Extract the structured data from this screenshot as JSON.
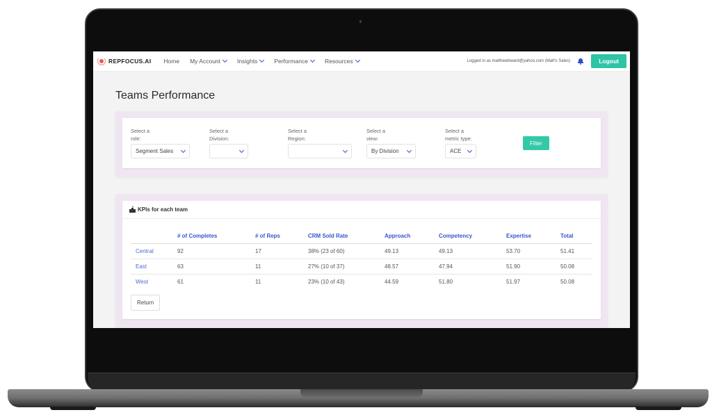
{
  "nav": {
    "brand": "REPFOCUS.AI",
    "items": [
      {
        "label": "Home",
        "has_dropdown": false
      },
      {
        "label": "My Account",
        "has_dropdown": true
      },
      {
        "label": "Insights",
        "has_dropdown": true
      },
      {
        "label": "Performance",
        "has_dropdown": true
      },
      {
        "label": "Resources",
        "has_dropdown": true
      }
    ],
    "logged_in_text": "Logged in as matthewbward@yahoo.com (Matt's Sales)",
    "logout_label": "Logout",
    "accent_color": "#2ec4a5",
    "link_color": "#2f4fc7"
  },
  "page": {
    "title": "Teams Performance"
  },
  "filters": {
    "role": {
      "label_line1": "Select a",
      "label_line2": "role:",
      "value": "Segment Sales"
    },
    "division": {
      "label_line1": "Select a",
      "label_line2": "Division:",
      "value": ""
    },
    "region": {
      "label_line1": "Select a",
      "label_line2": "Region:",
      "value": ""
    },
    "view": {
      "label_line1": "Select a",
      "label_line2": "view:",
      "value": "By Division"
    },
    "metric": {
      "label_line1": "Select a",
      "label_line2": "metric type:",
      "value": "ACE"
    },
    "filter_label": "Filter"
  },
  "kpi": {
    "heading": "KPIs for each team",
    "columns": [
      "",
      "# of Completes",
      "# of Reps",
      "CRM Sold Rate",
      "Approach",
      "Competency",
      "Expertise",
      "Total"
    ],
    "rows": [
      {
        "team": "Central",
        "completes": "92",
        "reps": "17",
        "crm": "38% (23 of 60)",
        "approach": "49.13",
        "competency": "49.13",
        "expertise": "53.70",
        "total": "51.41"
      },
      {
        "team": "East",
        "completes": "63",
        "reps": "11",
        "crm": "27% (10 of 37)",
        "approach": "48.57",
        "competency": "47.94",
        "expertise": "51.90",
        "total": "50.08"
      },
      {
        "team": "West",
        "completes": "61",
        "reps": "11",
        "crm": "23% (10 of 43)",
        "approach": "44.59",
        "competency": "51.80",
        "expertise": "51.97",
        "total": "50.08"
      }
    ],
    "return_label": "Return"
  }
}
